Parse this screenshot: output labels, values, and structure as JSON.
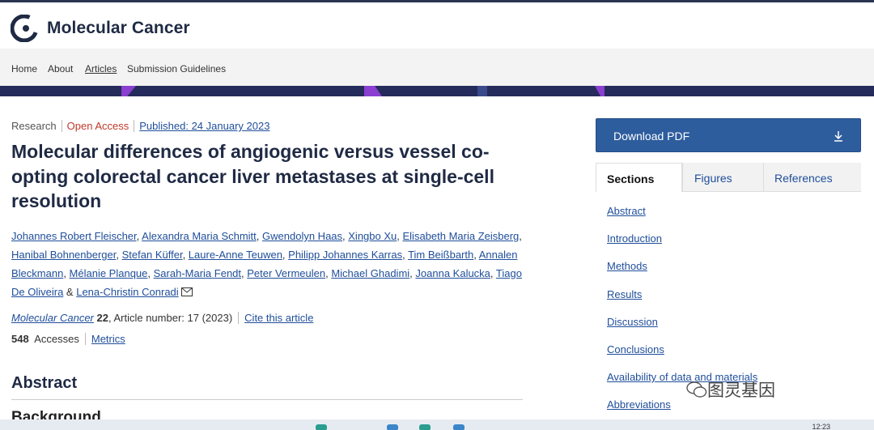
{
  "journal": {
    "title": "Molecular Cancer",
    "logo": "journal-logo-icon"
  },
  "nav": {
    "items": [
      {
        "label": "Home"
      },
      {
        "label": "About"
      },
      {
        "label": "Articles"
      },
      {
        "label": "Submission Guidelines"
      }
    ]
  },
  "article": {
    "type": "Research",
    "access": "Open Access",
    "published": "Published: 24 January 2023",
    "title": "Molecular differences of angiogenic versus vessel co-opting colorectal cancer liver metastases at single-cell resolution",
    "authors": [
      "Johannes Robert Fleischer",
      "Alexandra Maria Schmitt",
      "Gwendolyn Haas",
      "Xingbo Xu",
      "Elisabeth Maria Zeisberg",
      "Hanibal Bohnenberger",
      "Stefan Küffer",
      "Laure-Anne Teuwen",
      "Philipp Johannes Karras",
      "Tim Beißbarth",
      "Annalen Bleckmann",
      "Mélanie Planque",
      "Sarah-Maria Fendt",
      "Peter Vermeulen",
      "Michael Ghadimi",
      "Joanna Kalucka",
      "Tiago De Oliveira",
      "Lena-Christin Conradi"
    ],
    "authors_joiner": "&",
    "citation": {
      "journal": "Molecular Cancer",
      "volume": "22",
      "rest": ", Article number: 17 (2023)",
      "cite_label": "Cite this article"
    },
    "accesses_count": "548",
    "accesses_label": "Accesses",
    "metrics_label": "Metrics",
    "abstract_heading": "Abstract",
    "background_heading": "Background"
  },
  "sidebar": {
    "download_pdf": "Download PDF",
    "tabs": [
      {
        "label": "Sections"
      },
      {
        "label": "Figures"
      },
      {
        "label": "References"
      }
    ],
    "sections": [
      {
        "label": "Abstract"
      },
      {
        "label": "Introduction"
      },
      {
        "label": "Methods"
      },
      {
        "label": "Results"
      },
      {
        "label": "Discussion"
      },
      {
        "label": "Conclusions"
      },
      {
        "label": "Availability of data and materials"
      },
      {
        "label": "Abbreviations"
      }
    ]
  },
  "watermark": {
    "text": "图灵基因"
  },
  "taskbar": {
    "time": "12:23"
  },
  "colors": {
    "brand": "#1f2a44",
    "link": "#1f4e9a",
    "open_access": "#c0392b",
    "banner": "#252b5a",
    "banner_accent": "#8a3fd1",
    "pdf_button": "#2e5d9e"
  }
}
